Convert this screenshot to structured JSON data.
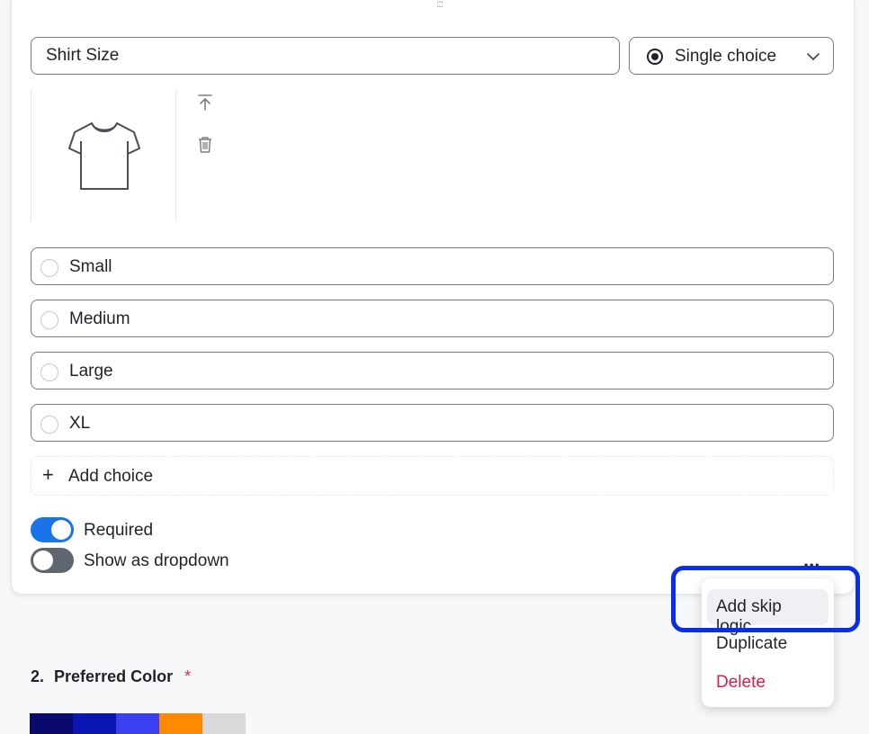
{
  "question": {
    "drag_handle": ":::",
    "title_value": "Shirt Size",
    "type_label": "Single choice",
    "choices": [
      "Small",
      "Medium",
      "Large",
      "XL"
    ],
    "add_choice_label": "Add choice",
    "required_label": "Required",
    "required_on": true,
    "dropdown_label": "Show as dropdown",
    "dropdown_on": false,
    "more_label": "..."
  },
  "context_menu": {
    "items": [
      "Add skip logic",
      "Duplicate",
      "Delete"
    ]
  },
  "next_question": {
    "number": "2.",
    "title": "Preferred Color",
    "required_mark": "*",
    "swatches": [
      "#0a0a6e",
      "#0a16b4",
      "#3b3ff0",
      "#ff8a00",
      "#d9d9d9"
    ]
  },
  "colors": {
    "accent": "#1a73e8",
    "danger": "#d6204b",
    "highlight": "#0a2ee8"
  }
}
